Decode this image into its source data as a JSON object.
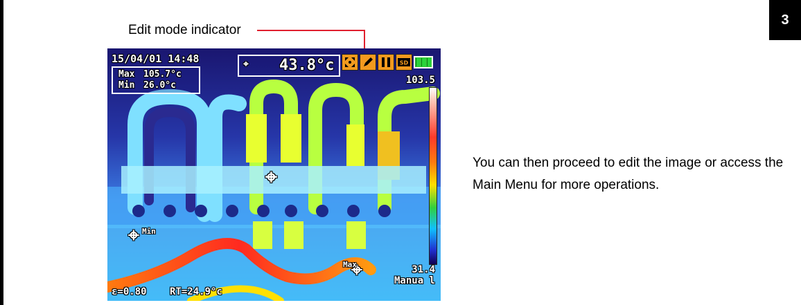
{
  "step_number": "3",
  "callout": {
    "label": "Edit mode indicator"
  },
  "description": "You can then proceed to edit the image or access the Main Menu for more operations.",
  "thermal_screen": {
    "datetime": "15/04/01 14:48",
    "max_label": "Max",
    "max_value": "105.7°c",
    "min_label": "Min",
    "min_value": "26.0°c",
    "center_temp": "43.8°c",
    "scale_max": "103.5",
    "scale_min": "31.4",
    "mode": "Manua l",
    "emissivity": "ε=0.80",
    "reflected_temp": "RT=24.9°c",
    "min_marker_label": "Min",
    "max_marker_label": "Max",
    "status_icons": [
      "fit-screen-icon",
      "edit-pencil-icon",
      "pause-icon",
      "sd-card-icon",
      "battery-icon"
    ],
    "colors": {
      "icon_bg": "#f39a1e",
      "callout_line": "#e0202e"
    }
  }
}
